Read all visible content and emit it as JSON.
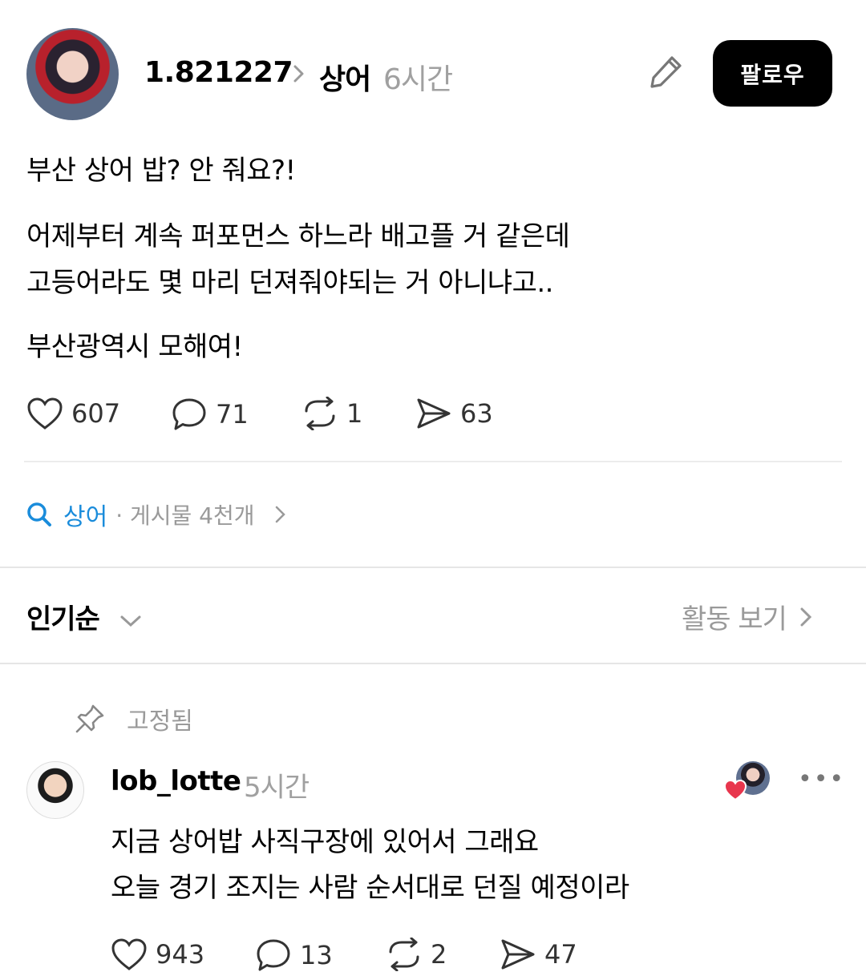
{
  "post": {
    "username": "1.821227",
    "topic": "상어",
    "time": "6시간",
    "follow_label": "팔로우",
    "lines": [
      "부산 상어 밥? 안 줘요?!",
      "어제부터 계속 퍼포먼스 하느라 배고플 거 같은데",
      "고등어라도 몇 마리 던져줘야되는 거 아니냐고..",
      "부산광역시 모해여!"
    ],
    "stats": {
      "likes": "607",
      "comments": "71",
      "reposts": "1",
      "shares": "63"
    }
  },
  "topic_row": {
    "topic": "상어",
    "meta": "· 게시물 4천개"
  },
  "sort": {
    "label": "인기순",
    "activity_label": "활동 보기"
  },
  "comment": {
    "pinned_label": "고정됨",
    "username": "lob_lotte",
    "time": "5시간",
    "more": "•••",
    "lines": [
      "지금 상어밥 사직구장에 있어서 그래요",
      "오늘 경기 조지는 사람 순서대로 던질 예정이라"
    ],
    "stats": {
      "likes": "943",
      "comments": "13",
      "reposts": "2",
      "shares": "47"
    }
  },
  "icons": {
    "heart": "heart-icon",
    "comment": "comment-icon",
    "repost": "repost-icon",
    "share": "share-icon",
    "search": "search-icon",
    "pencil": "pencil-icon",
    "pin": "pin-icon",
    "chevron": "chevron-right-icon"
  },
  "colors": {
    "accent": "#1a8cdb",
    "muted": "#9a9a9a",
    "follow_bg": "#000000",
    "heart_red": "#e8364d"
  }
}
